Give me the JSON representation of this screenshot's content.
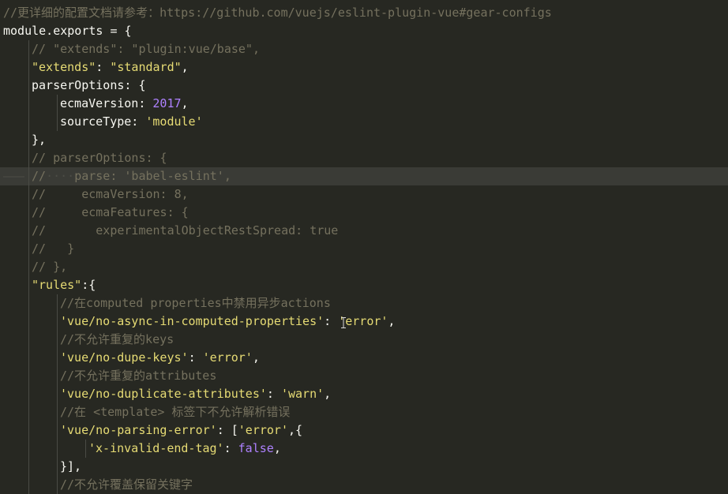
{
  "editor": {
    "colors": {
      "background": "#272822",
      "current_line": "#3a3b36",
      "comment": "#75715e",
      "string": "#e6db74",
      "number": "#ae81ff",
      "plain": "#f8f8f2"
    },
    "current_line_index": 9,
    "lines": [
      {
        "indent": 0,
        "tokens": [
          {
            "t": "cm",
            "v": "//更详细的配置文档请参考：https://github.com/vuejs/eslint-plugin-vue#gear-configs"
          }
        ]
      },
      {
        "indent": 0,
        "tokens": [
          {
            "t": "pl",
            "v": "module.exports = {"
          }
        ]
      },
      {
        "indent": 1,
        "tokens": [
          {
            "t": "cm",
            "v": "// \"extends\": \"plugin:vue/base\","
          }
        ]
      },
      {
        "indent": 1,
        "tokens": [
          {
            "t": "str",
            "v": "\"extends\""
          },
          {
            "t": "pl",
            "v": ": "
          },
          {
            "t": "str",
            "v": "\"standard\""
          },
          {
            "t": "pl",
            "v": ","
          }
        ]
      },
      {
        "indent": 1,
        "tokens": [
          {
            "t": "pl",
            "v": "parserOptions: {"
          }
        ]
      },
      {
        "indent": 2,
        "tokens": [
          {
            "t": "pl",
            "v": "ecmaVersion: "
          },
          {
            "t": "num",
            "v": "2017"
          },
          {
            "t": "pl",
            "v": ","
          }
        ]
      },
      {
        "indent": 2,
        "tokens": [
          {
            "t": "pl",
            "v": "sourceType: "
          },
          {
            "t": "str",
            "v": "'module'"
          }
        ]
      },
      {
        "indent": 1,
        "tokens": [
          {
            "t": "pl",
            "v": "},"
          }
        ]
      },
      {
        "indent": 1,
        "tokens": [
          {
            "t": "cm",
            "v": "// parserOptions: {"
          }
        ]
      },
      {
        "indent": 1,
        "current": true,
        "tokens": [
          {
            "t": "cm",
            "v": "//"
          },
          {
            "t": "ws-dot",
            "v": "····"
          },
          {
            "t": "cm",
            "v": "parse: 'babel-eslint',"
          }
        ]
      },
      {
        "indent": 1,
        "tokens": [
          {
            "t": "cm",
            "v": "//     ecmaVersion: 8,"
          }
        ]
      },
      {
        "indent": 1,
        "tokens": [
          {
            "t": "cm",
            "v": "//     ecmaFeatures: {"
          }
        ]
      },
      {
        "indent": 1,
        "tokens": [
          {
            "t": "cm",
            "v": "//       experimentalObjectRestSpread: true"
          }
        ]
      },
      {
        "indent": 1,
        "tokens": [
          {
            "t": "cm",
            "v": "//   }"
          }
        ]
      },
      {
        "indent": 1,
        "tokens": [
          {
            "t": "cm",
            "v": "// },"
          }
        ]
      },
      {
        "indent": 1,
        "tokens": [
          {
            "t": "str",
            "v": "\"rules\""
          },
          {
            "t": "pl",
            "v": ":{"
          }
        ]
      },
      {
        "indent": 2,
        "tokens": [
          {
            "t": "cm",
            "v": "//在computed properties中禁用异步actions"
          }
        ]
      },
      {
        "indent": 2,
        "tokens": [
          {
            "t": "str",
            "v": "'vue/no-async-in-computed-properties'"
          },
          {
            "t": "pl",
            "v": ": "
          },
          {
            "t": "str",
            "v": "'error'"
          },
          {
            "t": "pl",
            "v": ","
          }
        ]
      },
      {
        "indent": 2,
        "tokens": [
          {
            "t": "cm",
            "v": "//不允许重复的keys"
          }
        ]
      },
      {
        "indent": 2,
        "tokens": [
          {
            "t": "str",
            "v": "'vue/no-dupe-keys'"
          },
          {
            "t": "pl",
            "v": ": "
          },
          {
            "t": "str",
            "v": "'error'"
          },
          {
            "t": "pl",
            "v": ","
          }
        ]
      },
      {
        "indent": 2,
        "tokens": [
          {
            "t": "cm",
            "v": "//不允许重复的attributes"
          }
        ]
      },
      {
        "indent": 2,
        "tokens": [
          {
            "t": "str",
            "v": "'vue/no-duplicate-attributes'"
          },
          {
            "t": "pl",
            "v": ": "
          },
          {
            "t": "str",
            "v": "'warn'"
          },
          {
            "t": "pl",
            "v": ","
          }
        ]
      },
      {
        "indent": 2,
        "tokens": [
          {
            "t": "cm",
            "v": "//在 <template> 标签下不允许解析错误"
          }
        ]
      },
      {
        "indent": 2,
        "tokens": [
          {
            "t": "str",
            "v": "'vue/no-parsing-error'"
          },
          {
            "t": "pl",
            "v": ": ["
          },
          {
            "t": "str",
            "v": "'error'"
          },
          {
            "t": "pl",
            "v": ",{"
          }
        ]
      },
      {
        "indent": 3,
        "tokens": [
          {
            "t": "str",
            "v": "'x-invalid-end-tag'"
          },
          {
            "t": "pl",
            "v": ": "
          },
          {
            "t": "kw",
            "v": "false"
          },
          {
            "t": "pl",
            "v": ","
          }
        ]
      },
      {
        "indent": 2,
        "tokens": [
          {
            "t": "pl",
            "v": "}],"
          }
        ]
      },
      {
        "indent": 2,
        "tokens": [
          {
            "t": "cm",
            "v": "//不允许覆盖保留关键字"
          }
        ]
      }
    ]
  },
  "cursor_icon": "i-beam-icon"
}
